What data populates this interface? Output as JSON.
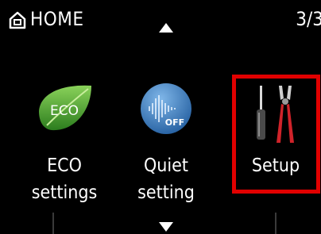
{
  "header": {
    "title": "HOME",
    "page_indicator": "3/3",
    "icon": "home-icon"
  },
  "navigation": {
    "up_icon": "arrow-up-icon",
    "down_icon": "arrow-down-icon"
  },
  "tiles": [
    {
      "label_line1": "ECO",
      "label_line2": "settings",
      "icon": "eco-leaf-icon",
      "icon_text": "ECO"
    },
    {
      "label_line1": "Quiet",
      "label_line2": "setting",
      "icon": "quiet-wave-icon",
      "icon_text": "OFF"
    },
    {
      "label_line1": "Setup",
      "label_line2": "",
      "icon": "screwdriver-pliers-icon",
      "selected": true
    }
  ],
  "colors": {
    "background": "#000000",
    "selection": "#e10000",
    "eco_green": "#3c9a2a",
    "quiet_blue": "#2d6fb4"
  }
}
